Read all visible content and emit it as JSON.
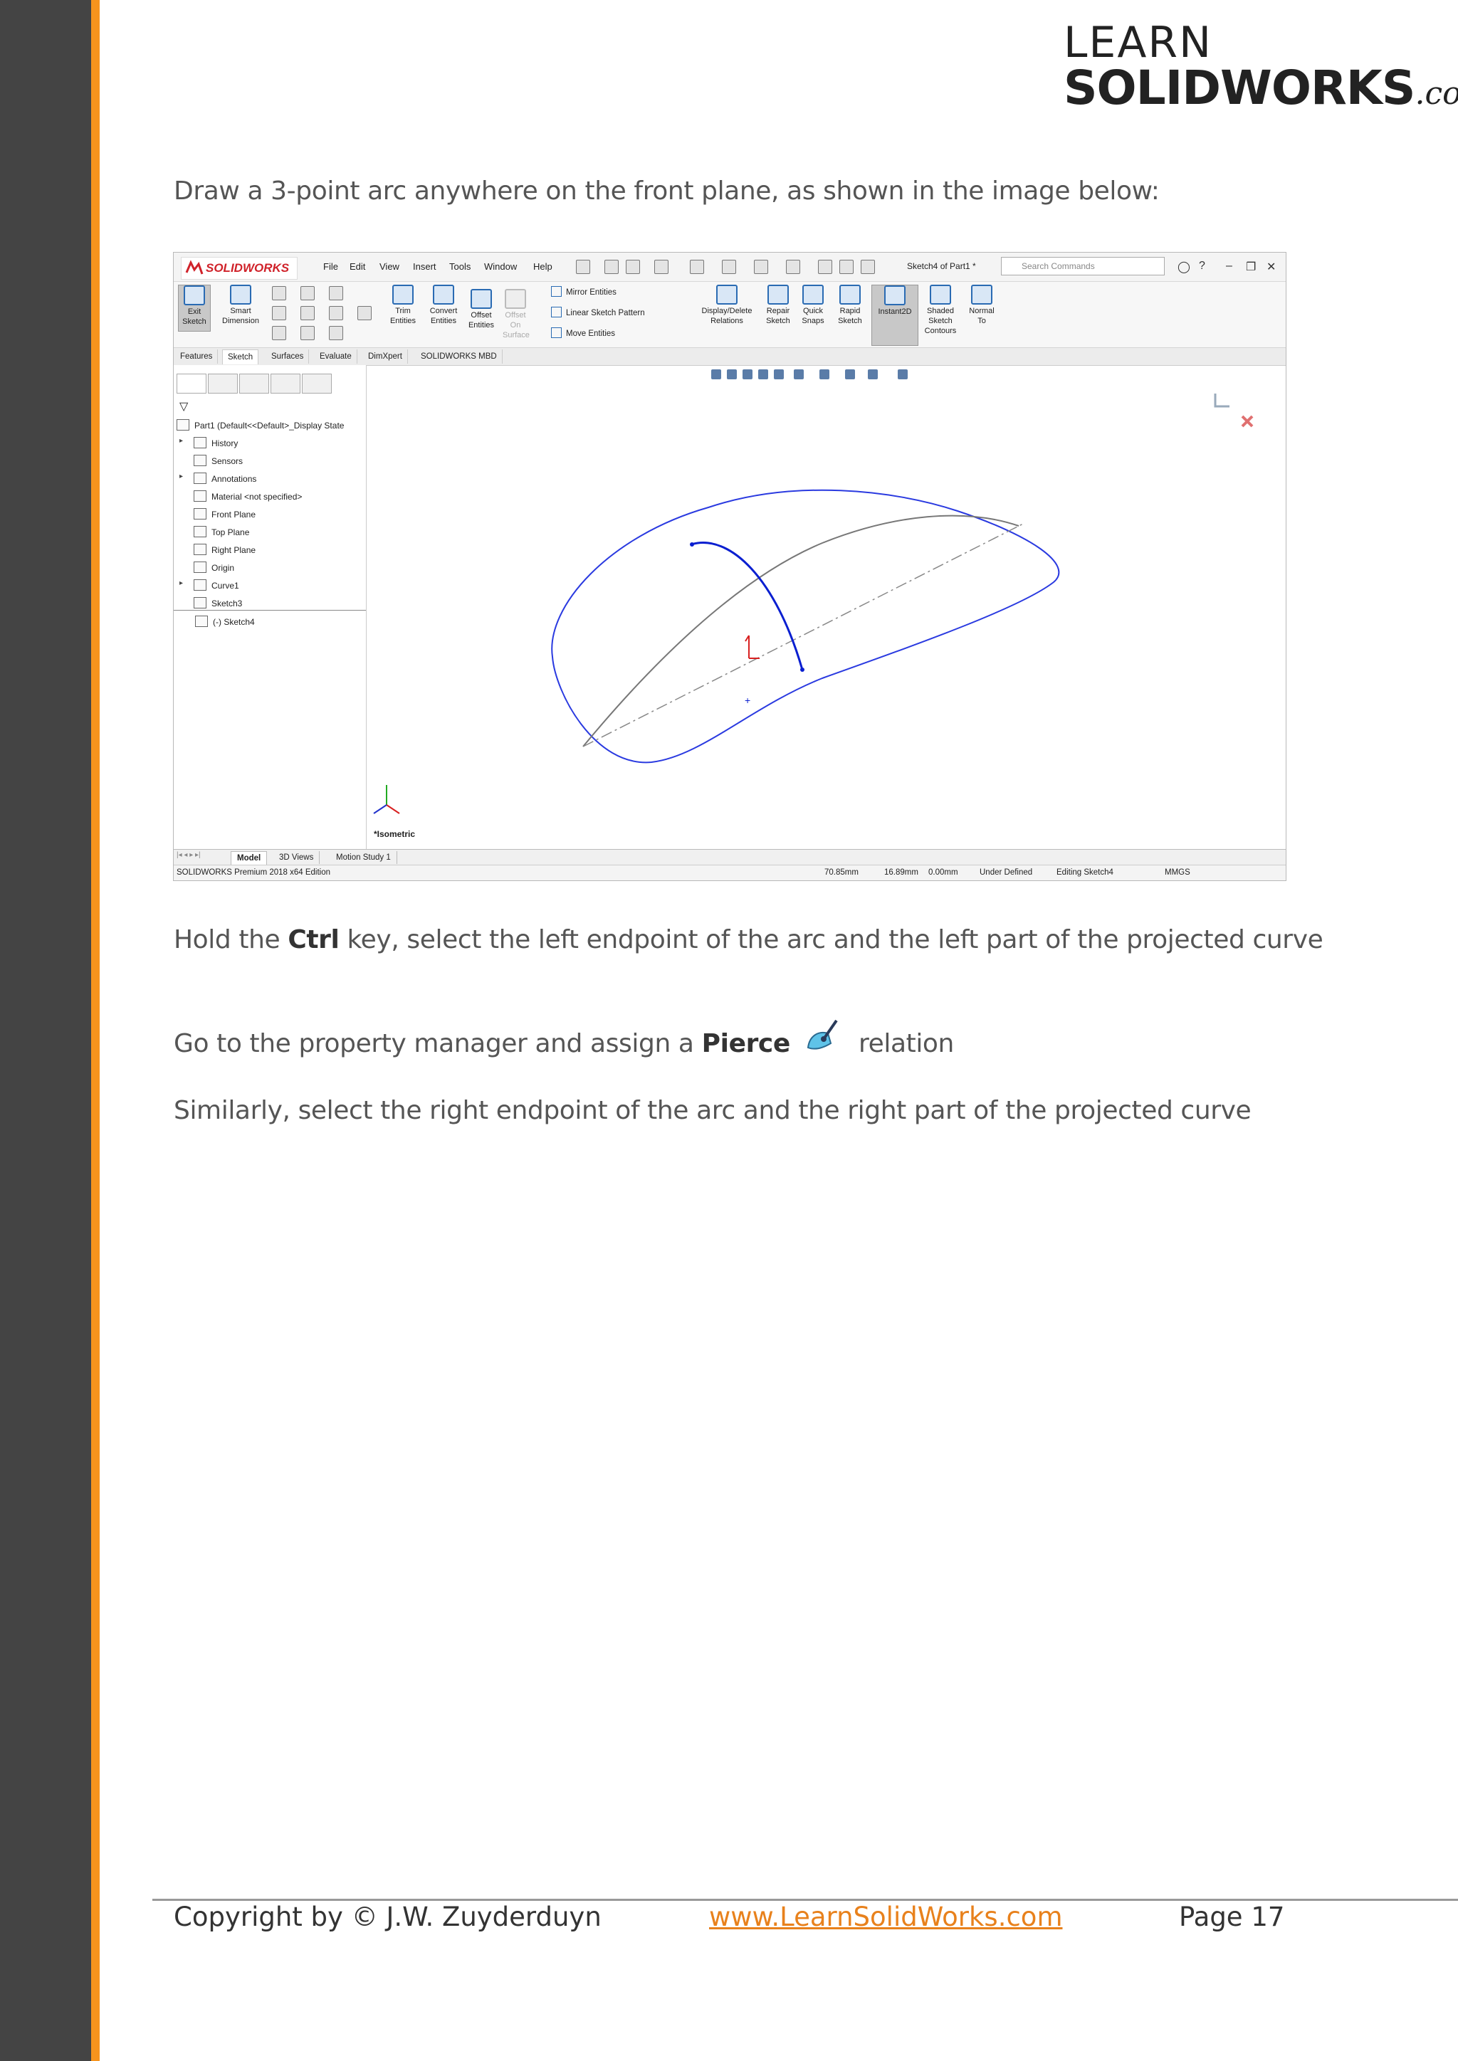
{
  "logo": {
    "line1": "LEARN",
    "line2": "SOLIDWORKS",
    "suffix": ".com"
  },
  "paragraphs": {
    "p1": "Draw a 3-point arc anywhere on the front plane, as shown in the image below:",
    "p2_pre": "Hold the ",
    "p2_bold": "Ctrl",
    "p2_post": " key, select the left endpoint of the arc and the left part of the projected curve",
    "p3_pre": "Go to the property manager and assign a ",
    "p3_bold": "Pierce",
    "p3_post": " relation",
    "p4": "Similarly, select the right endpoint of the arc and the right part of the projected curve"
  },
  "footer": {
    "copyright": "Copyright by © J.W. Zuyderduyn",
    "link": "www.LearnSolidWorks.com",
    "page": "Page 17"
  },
  "screenshot": {
    "brand": "SOLIDWORKS",
    "menu": [
      "File",
      "Edit",
      "View",
      "Insert",
      "Tools",
      "Window",
      "Help"
    ],
    "doc_title": "Sketch4 of Part1 *",
    "search_placeholder": "Search Commands",
    "ribbon": {
      "exit_sketch": [
        "Exit",
        "Sketch"
      ],
      "smart_dimension": [
        "Smart",
        "Dimension"
      ],
      "trim_entities": [
        "Trim",
        "Entities"
      ],
      "convert_entities": [
        "Convert",
        "Entities"
      ],
      "offset_entities": [
        "Offset",
        "Entities"
      ],
      "offset_on_surface": [
        "Offset",
        "On",
        "Surface"
      ],
      "mirror_entities": "Mirror Entities",
      "linear_sketch_pattern": "Linear Sketch Pattern",
      "move_entities": "Move Entities",
      "display_delete_relations": [
        "Display/Delete",
        "Relations"
      ],
      "repair_sketch": [
        "Repair",
        "Sketch"
      ],
      "quick_snaps": [
        "Quick",
        "Snaps"
      ],
      "rapid_sketch": [
        "Rapid",
        "Sketch"
      ],
      "instant2d": "Instant2D",
      "shaded_sketch_contours": [
        "Shaded",
        "Sketch",
        "Contours"
      ],
      "normal_to": [
        "Normal",
        "To"
      ]
    },
    "tabs": [
      "Features",
      "Sketch",
      "Surfaces",
      "Evaluate",
      "DimXpert",
      "SOLIDWORKS MBD"
    ],
    "active_tab": "Sketch",
    "tree": {
      "root": "Part1  (Default<<Default>_Display State",
      "items": [
        "History",
        "Sensors",
        "Annotations",
        "Material <not specified>",
        "Front Plane",
        "Top Plane",
        "Right Plane",
        "Origin",
        "Curve1",
        "Sketch3",
        "(-) Sketch4"
      ]
    },
    "view_label": "*Isometric",
    "bottom_tabs": [
      "Model",
      "3D Views",
      "Motion Study 1"
    ],
    "status": {
      "edition": "SOLIDWORKS Premium 2018 x64 Edition",
      "x": "70.85mm",
      "y": "16.89mm",
      "z": "0.00mm",
      "state": "Under Defined",
      "editing": "Editing Sketch4",
      "units": "MMGS"
    }
  }
}
